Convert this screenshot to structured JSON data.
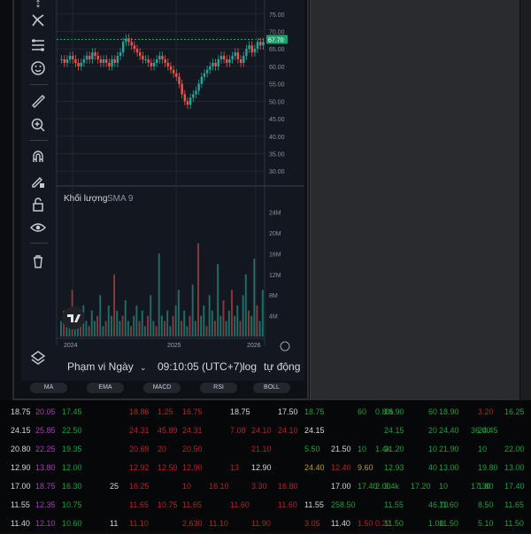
{
  "chart": {
    "price_ticks": [
      "75.00",
      "70.00",
      "65.00",
      "60.00",
      "55.00",
      "50.00",
      "45.00",
      "40.00",
      "35.00",
      "30.00"
    ],
    "price_min": 27,
    "price_max": 79,
    "last_price_label": "67.70",
    "last_price": 67.7,
    "volume_label": "Khối lượng",
    "volume_sma_label": "SMA 9",
    "volume_ticks": [
      "24M",
      "20M",
      "16M",
      "12M",
      "8M",
      "4M"
    ],
    "volume_max": 27,
    "x_ticks": [
      "2024",
      "2025",
      "2026"
    ],
    "bullish_color": "#26a69a",
    "bearish_color": "#ef5350",
    "price_series": [
      62,
      61,
      62,
      63,
      62,
      61,
      60,
      61,
      62,
      63,
      62,
      64,
      63,
      62,
      61,
      62,
      61,
      60,
      62,
      61,
      63,
      64,
      67,
      68,
      67,
      66,
      65,
      64,
      63,
      62,
      62,
      61,
      60,
      61,
      62,
      63,
      62,
      61,
      60,
      59,
      58,
      57,
      55,
      52,
      50,
      49,
      51,
      52,
      53,
      55,
      57,
      58,
      59,
      60,
      61,
      60,
      62,
      63,
      62,
      61,
      62,
      63,
      64,
      62,
      61,
      63,
      65,
      66,
      64,
      65,
      67,
      66,
      67
    ],
    "volume_series": [
      3,
      5,
      2,
      4,
      9,
      3,
      2,
      4,
      6,
      3,
      2,
      5,
      3,
      4,
      8,
      2,
      3,
      6,
      4,
      12,
      5,
      3,
      4,
      7,
      3,
      2,
      4,
      6,
      3,
      5,
      2,
      4,
      8,
      3,
      2,
      16,
      4,
      3,
      5,
      2,
      4,
      6,
      9,
      3,
      5,
      2,
      4,
      10,
      3,
      18,
      4,
      6,
      2,
      8,
      5,
      3,
      14,
      4,
      7,
      3,
      5,
      9,
      4,
      6,
      3,
      8,
      12,
      5,
      4,
      15,
      6,
      3,
      9
    ]
  },
  "bottom_bar": {
    "range_label": "Phạm vi Ngày",
    "range_chevron": "chevron-down-icon",
    "time": "09:10:05 (UTC+7)",
    "log": "log",
    "auto": "tự động"
  },
  "indicators": [
    "MA",
    "EMA",
    "MACD",
    "RSI",
    "BOLL"
  ],
  "toolbar_icons": [
    "trend-line-icon",
    "fib-icon",
    "pattern-icon",
    "emoji-icon",
    "ruler-icon",
    "zoom-in-icon",
    "magnet-icon",
    "pencil-lock-icon",
    "lock-icon",
    "eye-icon",
    "trash-icon",
    "layers-icon"
  ],
  "table": {
    "rows": [
      [
        "18.75",
        "20.05",
        "17.45",
        "",
        "",
        "18.86",
        "1.25",
        "16.75",
        "",
        "18.75",
        "",
        "17.50",
        "18.75",
        "",
        "60",
        "0.8%",
        "18.90",
        "",
        "60",
        "18.90",
        "",
        "3.20",
        "16.25"
      ],
      [
        "24.15",
        "25.85",
        "22.50",
        "",
        "",
        "24.31",
        "45.89",
        "24.31",
        "",
        "7.08",
        "24.10",
        "24.10",
        "24.15",
        "",
        "",
        "",
        "24.15",
        "",
        "20",
        "24.40",
        "36.00",
        "24.45",
        ""
      ],
      [
        "20.80",
        "22.25",
        "19.35",
        "",
        "",
        "20.69",
        "20",
        "20.50",
        "",
        "",
        "21.10",
        "",
        "5.50",
        "21.50",
        "10",
        "1.4k",
        "21.20",
        "",
        "10",
        "21.90",
        "",
        "10",
        "22.00"
      ],
      [
        "12.90",
        "13.80",
        "12.00",
        "",
        "",
        "12.92",
        "12.50",
        "12.90",
        "",
        "13",
        "12.90",
        "",
        "24.40",
        "12.40",
        "9.60",
        "",
        "12.93",
        "",
        "40",
        "13.00",
        "",
        "19.80",
        "13.00"
      ],
      [
        "17.00",
        "18.75",
        "16.30",
        "",
        "25",
        "16.25",
        "",
        "10",
        "16.10",
        "",
        "3.30",
        "16.80",
        "",
        "17.00",
        "17.40",
        "2.00",
        "3.4k",
        "17.20",
        "",
        "10",
        "17.30",
        "1.80",
        "17.40"
      ],
      [
        "11.55",
        "12.35",
        "10.75",
        "",
        "",
        "11.65",
        "10.75",
        "11.65",
        "",
        "11.60",
        "",
        "11.60",
        "11.55",
        "258.50",
        "",
        "",
        "11.55",
        "",
        "46.70",
        "11.60",
        "",
        "8.50",
        "11.65"
      ],
      [
        "11.40",
        "12.10",
        "10.60",
        "",
        "11",
        "11.10",
        "",
        "2,630",
        "11.10",
        "",
        "11.90",
        "",
        "3.05",
        "11.40",
        "1.50",
        "0.22",
        "11.50",
        "",
        "1.00",
        "11.50",
        "",
        "5.10",
        "11.50"
      ]
    ],
    "row_colors": [
      [
        "cw",
        "cm",
        "cg",
        "",
        "",
        "cr",
        "cr",
        "cr",
        "",
        "cw",
        "",
        "cw",
        "cg",
        "",
        "cg",
        "cg",
        "cg",
        "",
        "cg",
        "cg",
        "",
        "cr",
        "cg"
      ],
      [
        "cw",
        "cm",
        "cg",
        "",
        "",
        "cr",
        "cr",
        "cr",
        "",
        "cr",
        "cr",
        "cr",
        "cw",
        "",
        "",
        "",
        "cg",
        "",
        "cg",
        "cg",
        "cg",
        "cg",
        ""
      ],
      [
        "cw",
        "cm",
        "cg",
        "",
        "",
        "cr",
        "cr",
        "cr",
        "",
        "",
        "cr",
        "",
        "cg",
        "cw",
        "cg",
        "cg",
        "cg",
        "",
        "cg",
        "cg",
        "",
        "cg",
        "cg"
      ],
      [
        "cw",
        "cm",
        "cg",
        "",
        "",
        "cr",
        "cr",
        "cr",
        "",
        "cr",
        "cw",
        "",
        "cy",
        "cr",
        "cy",
        "",
        "cg",
        "",
        "cg",
        "cg",
        "",
        "cg",
        "cg"
      ],
      [
        "cw",
        "cm",
        "cg",
        "",
        "cw",
        "cr",
        "",
        "cr",
        "cr",
        "",
        "cr",
        "cr",
        "",
        "cw",
        "cg",
        "cg",
        "cg",
        "cg",
        "",
        "cg",
        "cg",
        "cg",
        "cg"
      ],
      [
        "cw",
        "cm",
        "cg",
        "",
        "",
        "cr",
        "cr",
        "cr",
        "",
        "cr",
        "",
        "cr",
        "cw",
        "cg",
        "",
        "",
        "cg",
        "",
        "cg",
        "cg",
        "",
        "cg",
        "cg"
      ],
      [
        "cw",
        "cm",
        "cg",
        "",
        "cw",
        "cr",
        "",
        "cr",
        "cr",
        "",
        "cr",
        "",
        "cr",
        "cw",
        "cr",
        "cr",
        "cg",
        "",
        "cg",
        "cg",
        "",
        "cg",
        "cg"
      ]
    ]
  }
}
